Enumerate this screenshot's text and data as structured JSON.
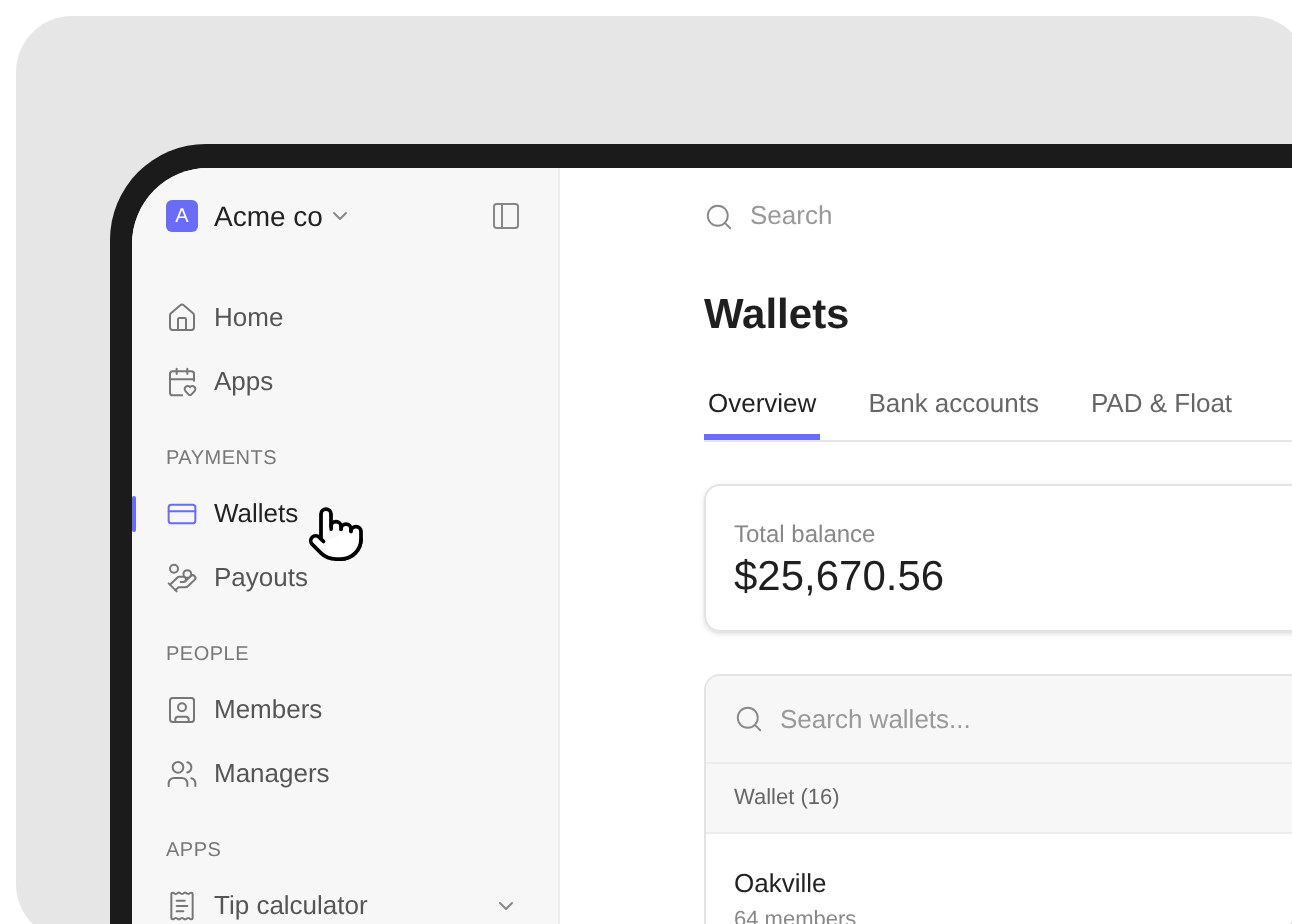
{
  "workspace": {
    "initial": "A",
    "name": "Acme co"
  },
  "sidebar": {
    "sections": [
      {
        "items": [
          {
            "kind": "link",
            "label": "Home",
            "selected": false
          },
          {
            "kind": "link",
            "label": "Apps",
            "selected": false
          }
        ]
      },
      {
        "heading": "PAYMENTS",
        "items": [
          {
            "kind": "link",
            "label": "Wallets",
            "selected": true
          },
          {
            "kind": "link",
            "label": "Payouts",
            "selected": false
          }
        ]
      },
      {
        "heading": "PEOPLE",
        "items": [
          {
            "kind": "link",
            "label": "Members",
            "selected": false
          },
          {
            "kind": "link",
            "label": "Managers",
            "selected": false
          }
        ]
      },
      {
        "heading": "APPS",
        "items": [
          {
            "kind": "group",
            "label": "Tip calculator",
            "selected": false,
            "expanded": false
          }
        ]
      }
    ]
  },
  "search": {
    "placeholder": "Search"
  },
  "page_title": "Wallets",
  "tabs": [
    {
      "label": "Overview",
      "selected": true
    },
    {
      "label": "Bank accounts",
      "selected": false
    },
    {
      "label": "PAD & Float",
      "selected": false
    }
  ],
  "balance": {
    "label": "Total balance",
    "value": "$25,670.56"
  },
  "wallets": {
    "search_placeholder": "Search wallets...",
    "column": "Wallet (16)",
    "rows": [
      {
        "name": "Oakville",
        "members": "64 members"
      }
    ]
  }
}
